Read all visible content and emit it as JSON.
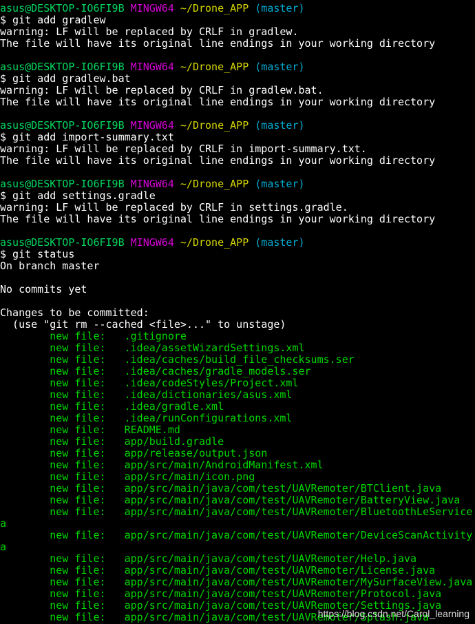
{
  "colors": {
    "background": "#000000",
    "text": "#ffffff",
    "user": "#00d75f",
    "mingw": "#d700d7",
    "path": "#d7d700",
    "branch": "#00afd7",
    "staged": "#00d700"
  },
  "prompt": {
    "user_host": "asus@DESKTOP-IO6FI9B",
    "env": "MINGW64",
    "path": "~/Drone_APP",
    "branch": "(master)"
  },
  "blocks": [
    {
      "command": "$ git add gradlew",
      "output": [
        "warning: LF will be replaced by CRLF in gradlew.",
        "The file will have its original line endings in your working directory"
      ]
    },
    {
      "command": "$ git add gradlew.bat",
      "output": [
        "warning: LF will be replaced by CRLF in gradlew.bat.",
        "The file will have its original line endings in your working directory"
      ]
    },
    {
      "command": "$ git add import-summary.txt",
      "output": [
        "warning: LF will be replaced by CRLF in import-summary.txt.",
        "The file will have its original line endings in your working directory"
      ]
    },
    {
      "command": "$ git add settings.gradle",
      "output": [
        "warning: LF will be replaced by CRLF in settings.gradle.",
        "The file will have its original line endings in your working directory"
      ]
    }
  ],
  "status": {
    "command": "$ git status",
    "branch_line": "On branch master",
    "no_commits": "No commits yet",
    "changes_header": "Changes to be committed:",
    "hint": "  (use \"git rm --cached <file>...\" to unstage)",
    "files": [
      "        new file:   .gitignore",
      "        new file:   .idea/assetWizardSettings.xml",
      "        new file:   .idea/caches/build_file_checksums.ser",
      "        new file:   .idea/caches/gradle_models.ser",
      "        new file:   .idea/codeStyles/Project.xml",
      "        new file:   .idea/dictionaries/asus.xml",
      "        new file:   .idea/gradle.xml",
      "        new file:   .idea/runConfigurations.xml",
      "        new file:   README.md",
      "        new file:   app/build.gradle",
      "        new file:   app/release/output.json",
      "        new file:   app/src/main/AndroidManifest.xml",
      "        new file:   app/src/main/icon.png",
      "        new file:   app/src/main/java/com/test/UAVRemoter/BTClient.java",
      "        new file:   app/src/main/java/com/test/UAVRemoter/BatteryView.java",
      "        new file:   app/src/main/java/com/test/UAVRemoter/BluetoothLeService.jav",
      "a",
      "        new file:   app/src/main/java/com/test/UAVRemoter/DeviceScanActivity.ja",
      "a",
      "        new file:   app/src/main/java/com/test/UAVRemoter/Help.java",
      "        new file:   app/src/main/java/com/test/UAVRemoter/License.java",
      "        new file:   app/src/main/java/com/test/UAVRemoter/MySurfaceView.java",
      "        new file:   app/src/main/java/com/test/UAVRemoter/Protocol.java",
      "        new file:   app/src/main/java/com/test/UAVRemoter/Settings.java",
      "        new file:   app/src/main/java/com/test/UAVRemoter/Splash.java"
    ]
  },
  "watermark": "https://blog.csdn.net/Carol_learning"
}
